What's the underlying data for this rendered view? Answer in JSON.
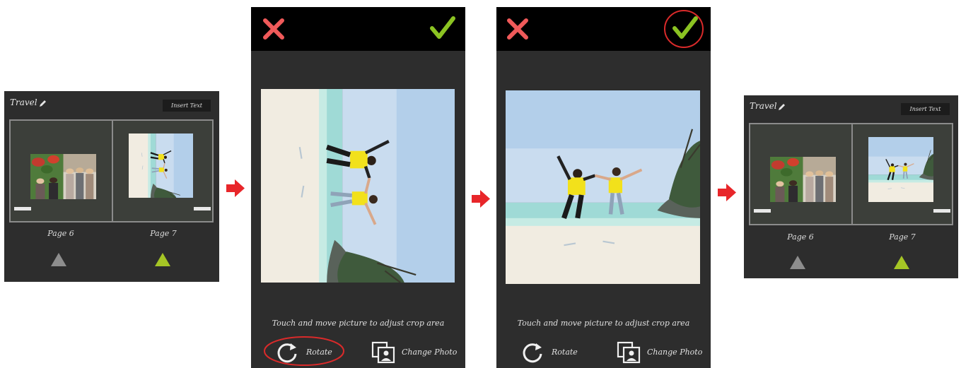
{
  "colors": {
    "accent_green": "#a5c525",
    "arrow_red": "#e8262a",
    "cancel_red": "#f05a5a",
    "confirm_green": "#8bc322",
    "highlight_circle": "#d92a2a"
  },
  "book_before": {
    "title": "Travel",
    "insert_text_label": "Insert Text",
    "left_page_label": "Page 6",
    "right_page_label": "Page 7"
  },
  "crop_rotated": {
    "hint": "Touch and move picture to adjust crop area",
    "rotate_label": "Rotate",
    "change_photo_label": "Change Photo",
    "cancel_icon": "close-x-icon",
    "confirm_icon": "checkmark-icon"
  },
  "crop_upright": {
    "hint": "Touch and move picture to adjust crop area",
    "rotate_label": "Rotate",
    "change_photo_label": "Change Photo",
    "cancel_icon": "close-x-icon",
    "confirm_icon": "checkmark-icon"
  },
  "book_after": {
    "title": "Travel",
    "insert_text_label": "Insert Text",
    "left_page_label": "Page 6",
    "right_page_label": "Page 7"
  }
}
